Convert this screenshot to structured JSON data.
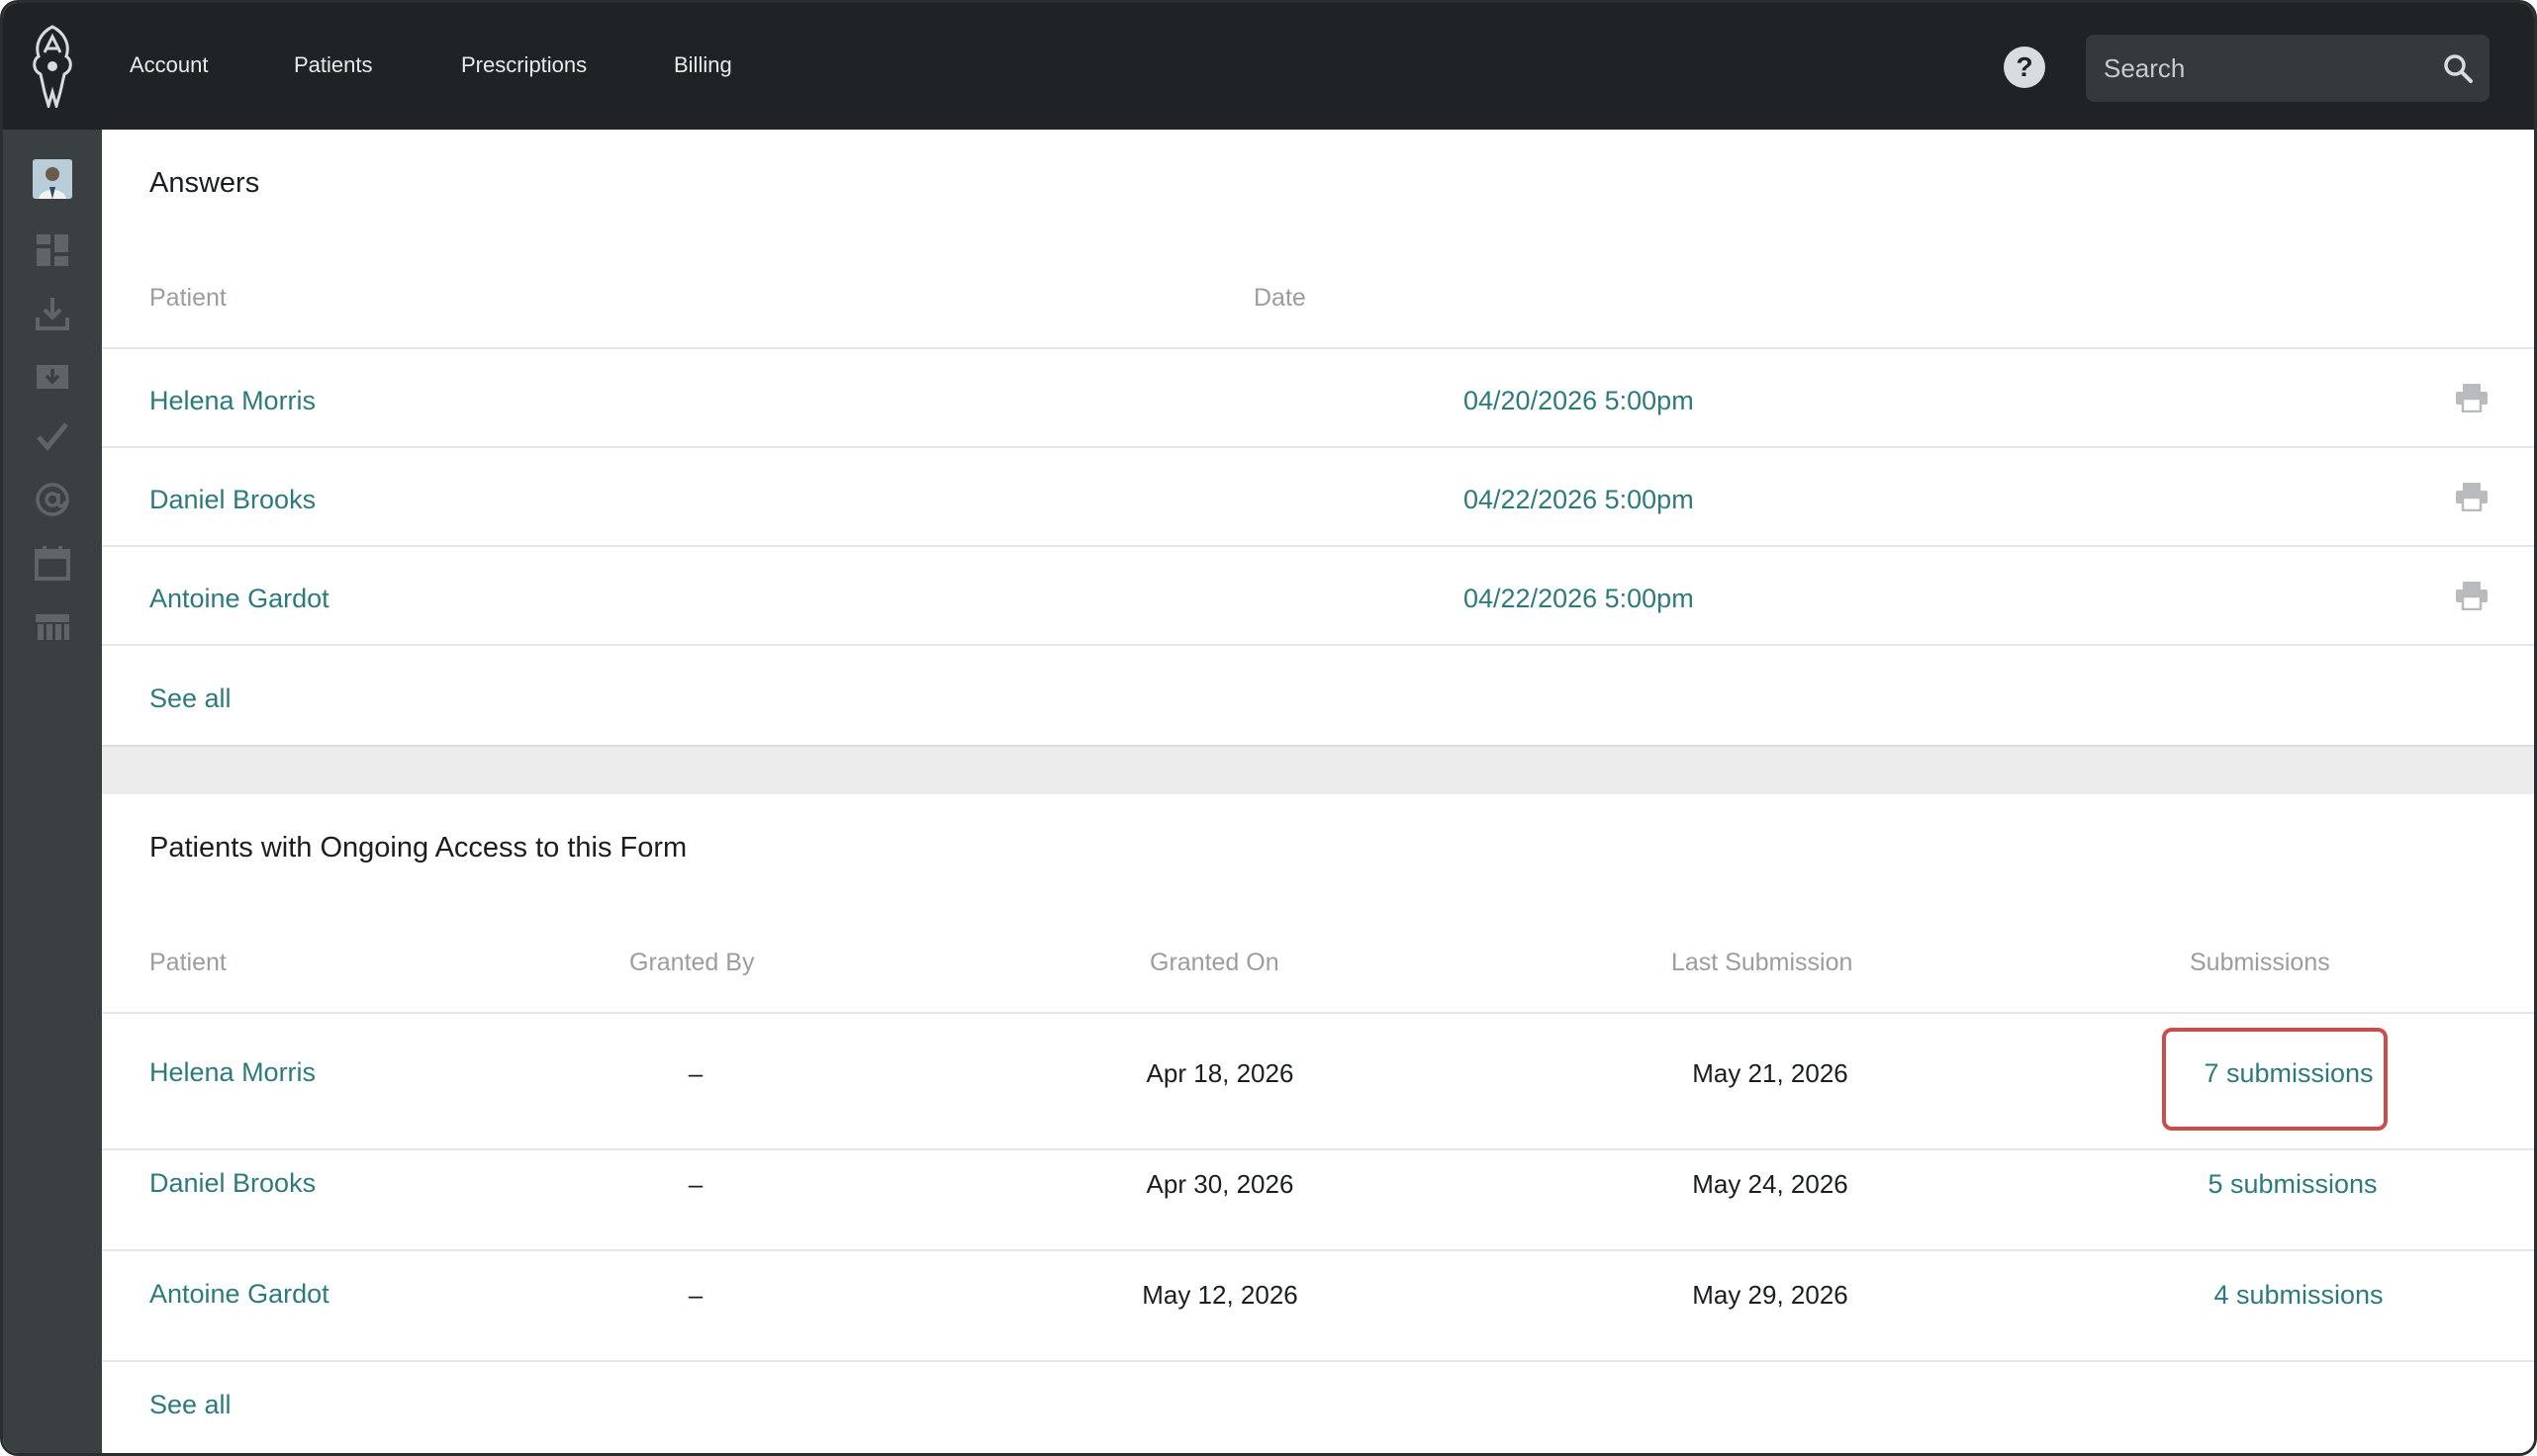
{
  "nav": {
    "items": [
      "Account",
      "Patients",
      "Prescriptions",
      "Billing"
    ],
    "help_label": "?",
    "search_placeholder": "Search"
  },
  "sidebar": {
    "icons": [
      "avatar",
      "dashboard-icon",
      "download-icon",
      "inbox-download-icon",
      "check-icon",
      "at-icon",
      "calendar-icon",
      "library-icon"
    ]
  },
  "answers": {
    "title": "Answers",
    "columns": {
      "patient": "Patient",
      "date": "Date"
    },
    "rows": [
      {
        "patient": "Helena Morris",
        "date": "04/20/2026 5:00pm"
      },
      {
        "patient": "Daniel Brooks",
        "date": "04/22/2026 5:00pm"
      },
      {
        "patient": "Antoine Gardot",
        "date": "04/22/2026 5:00pm"
      }
    ],
    "see_all": "See all"
  },
  "ongoing": {
    "title": "Patients with Ongoing Access to this Form",
    "columns": {
      "patient": "Patient",
      "granted_by": "Granted By",
      "granted_on": "Granted On",
      "last_submission": "Last Submission",
      "submissions": "Submissions"
    },
    "rows": [
      {
        "patient": "Helena Morris",
        "granted_by": "–",
        "granted_on": "Apr 18, 2026",
        "last_submission": "May 21, 2026",
        "submissions": "7 submissions"
      },
      {
        "patient": "Daniel Brooks",
        "granted_by": "–",
        "granted_on": "Apr 30, 2026",
        "last_submission": "May 24, 2026",
        "submissions": "5 submissions"
      },
      {
        "patient": "Antoine Gardot",
        "granted_by": "–",
        "granted_on": "May 12, 2026",
        "last_submission": "May 29, 2026",
        "submissions": "4 submissions"
      }
    ],
    "see_all": "See all"
  },
  "colors": {
    "topbar": "#1f2325",
    "sidebar": "#3a3f42",
    "link": "#2d7a7d",
    "highlight": "#cc4b4b"
  }
}
